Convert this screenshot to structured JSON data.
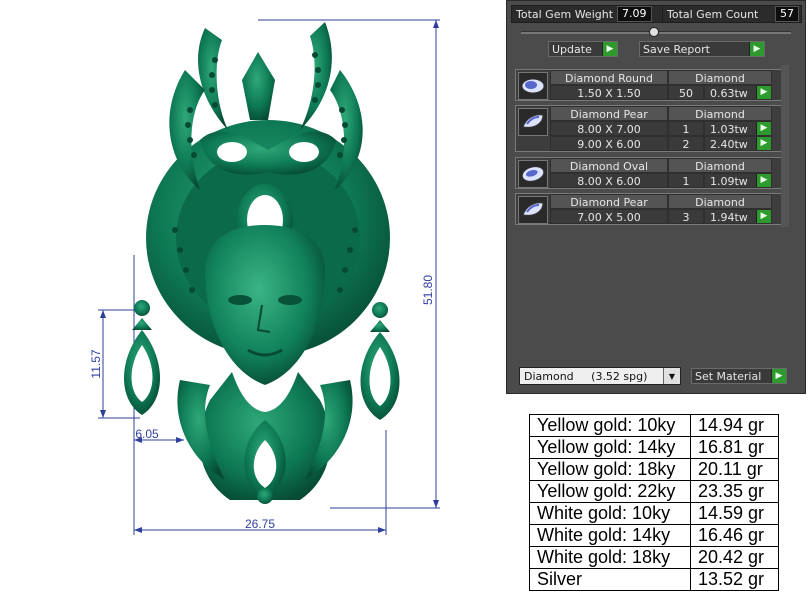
{
  "dimensions": {
    "height_total": "51.80",
    "width_total": "26.75",
    "earring_height": "11.57",
    "earring_width": "6.05"
  },
  "gem_panel": {
    "total_weight_label": "Total Gem Weight",
    "total_weight_value": "7.09",
    "total_count_label": "Total Gem Count",
    "total_count_value": "57",
    "update_label": "Update",
    "save_report_label": "Save Report",
    "groups": [
      {
        "name": "Diamond Round",
        "material": "Diamond",
        "icon": "round-gem-icon",
        "rows": [
          {
            "size": "1.50 X 1.50",
            "count": "50",
            "weight": "0.63tw"
          }
        ]
      },
      {
        "name": "Diamond Pear",
        "material": "Diamond",
        "icon": "pear-gem-icon",
        "rows": [
          {
            "size": "8.00 X 7.00",
            "count": "1",
            "weight": "1.03tw"
          },
          {
            "size": "9.00 X 6.00",
            "count": "2",
            "weight": "2.40tw"
          }
        ]
      },
      {
        "name": "Diamond Oval",
        "material": "Diamond",
        "icon": "oval-gem-icon",
        "rows": [
          {
            "size": "8.00 X 6.00",
            "count": "1",
            "weight": "1.09tw"
          }
        ]
      },
      {
        "name": "Diamond Pear",
        "material": "Diamond",
        "icon": "pear-gem-icon",
        "rows": [
          {
            "size": "7.00 X 5.00",
            "count": "3",
            "weight": "1.94tw"
          }
        ]
      }
    ],
    "material_select_value": "Diamond     (3.52 spg)",
    "set_material_label": "Set Material"
  },
  "metal_weights": [
    {
      "metal": "Yellow gold: 10ky",
      "weight": "14.94 gr"
    },
    {
      "metal": "Yellow gold: 14ky",
      "weight": "16.81 gr"
    },
    {
      "metal": "Yellow gold: 18ky",
      "weight": "20.11 gr"
    },
    {
      "metal": "Yellow gold: 22ky",
      "weight": "23.35 gr"
    },
    {
      "metal": "White gold: 10ky",
      "weight": "14.59 gr"
    },
    {
      "metal": "White gold: 14ky",
      "weight": "16.46 gr"
    },
    {
      "metal": "White gold: 18ky",
      "weight": "20.42 gr"
    },
    {
      "metal": "Silver",
      "weight": "13.52 gr"
    }
  ],
  "colors": {
    "model_green": "#0e7a55",
    "dimension_blue": "#2f3f9f",
    "panel_bg": "#4b4b4b",
    "arrow_green": "#2e9a2e"
  }
}
